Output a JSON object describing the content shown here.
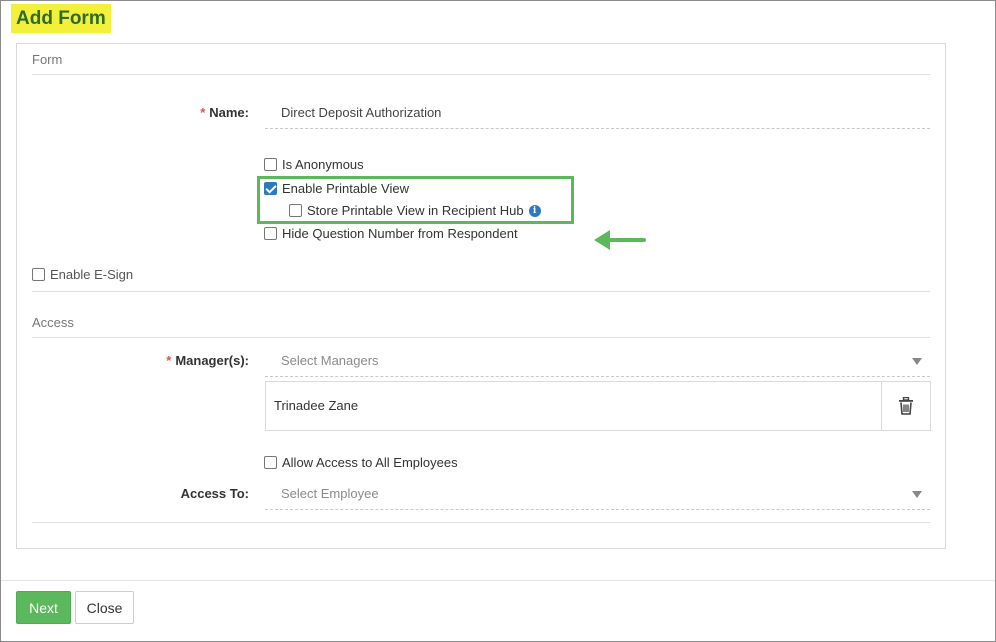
{
  "page": {
    "title": "Add Form"
  },
  "form_section": {
    "label": "Form",
    "name_label": "Name:",
    "name_value": "Direct Deposit Authorization",
    "options": [
      {
        "label": "Is Anonymous",
        "checked": false
      },
      {
        "label": "Enable Printable View",
        "checked": true
      },
      {
        "label": "Store Printable View in Recipient Hub",
        "checked": false,
        "info_icon": "info-icon"
      },
      {
        "label": "Hide Question Number from Respondent",
        "checked": false
      }
    ],
    "esign": {
      "label": "Enable E-Sign",
      "checked": false
    }
  },
  "access_section": {
    "label": "Access",
    "managers_label": "Manager(s):",
    "managers_placeholder": "Select Managers",
    "selected_managers": [
      "Trinadee Zane"
    ],
    "allow_all": {
      "label": "Allow Access to All Employees",
      "checked": false
    },
    "access_to_label": "Access To:",
    "access_to_placeholder": "Select Employee"
  },
  "footer": {
    "next_label": "Next",
    "close_label": "Close"
  },
  "colors": {
    "highlight": "#f3f03a",
    "accent_green": "#5cb85c",
    "checkbox_blue": "#2b78c5",
    "required_red": "#d9534f"
  },
  "required_marker": "*"
}
